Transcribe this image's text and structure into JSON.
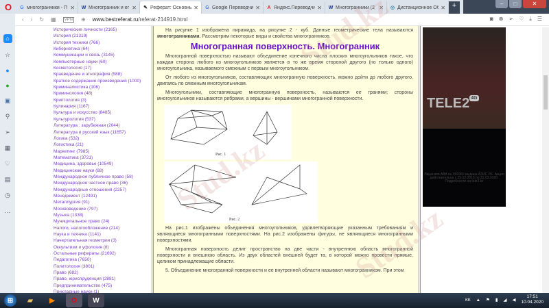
{
  "browser": {
    "tabs": [
      {
        "label": "многогранники - П",
        "favicon": "G",
        "color": "#4285f4"
      },
      {
        "label": "Многогранник и ег",
        "favicon": "W",
        "color": "#1a3a8a"
      },
      {
        "label": "Реферат: Основные",
        "favicon": "✎",
        "color": "#333",
        "active": true
      },
      {
        "label": "Google Переводчи",
        "favicon": "G",
        "color": "#4a7fe0"
      },
      {
        "label": "Яндекс.Переводчи",
        "favicon": "A",
        "color": "#e02020"
      },
      {
        "label": "Многогранники (2",
        "favicon": "W",
        "color": "#1a3a8a"
      },
      {
        "label": "Дистанционное Об",
        "favicon": "◎",
        "color": "#38a"
      }
    ],
    "url_domain": "www.bestreferat.ru",
    "url_path": "/referat-214919.html",
    "vpn": "VPN",
    "new_tab": "+"
  },
  "categories": [
    "Исторические личности (2165)",
    "История (21319)",
    "История техники (766)",
    "Кибернетика (64)",
    "Коммуникации и связь (3145)",
    "Компьютерные науки (60)",
    "Косметология (17)",
    "Краеведение и этнография (588)",
    "Краткое содержание произведений (1000)",
    "Криминалистика (106)",
    "Криминология (48)",
    "Криптология (3)",
    "Кулинария (1167)",
    "Культура и искусство (8485)",
    "Культурология (537)",
    "Литература : зарубежная (2044)",
    "Литература и русский язык (11657)",
    "Логика (532)",
    "Логистика (21)",
    "Маркетинг (7985)",
    "Математика (3721)",
    "Медицина, здоровье (10549)",
    "Медицинские науки (88)",
    "Международное публичное право (58)",
    "Международное частное право (36)",
    "Международные отношения (2257)",
    "Менеджмент (12491)",
    "Металлургия (91)",
    "Москвоведение (797)",
    "Музыка (1338)",
    "Муниципальное право (24)",
    "Налоги, налогообложение (214)",
    "Наука и техника (1141)",
    "Начертательная геометрия (3)",
    "Оккультизм и уфология (8)",
    "Остальные рефераты (21692)",
    "Педагогика (7650)",
    "Политология (3801)",
    "Право (682)",
    "Право, юриспруденция (2881)",
    "Предпринимательство (475)",
    "Прикладные науки (1)"
  ],
  "article": {
    "intro": "На рисунке 1 изображена пирамида, на рисунке 2 - куб. Данные геометрические тела называются",
    "intro_bold": "многогранниками.",
    "intro_rest": " Рассмотрим некоторые виды и свойства многогранников.",
    "heading": "Многогранная поверхность. Многогранник",
    "p1": "Многогранной поверхностью называют объединение конечного числа плоских многоугольников такое, что каждая сторона любого из многоугольников является в то же время стороной другого (но только одного) многоугольника, называемого смежным с первым многоугольником.",
    "p2": "От любого из многоугольников, составляющих многогранную поверхность, можно дойти до любого другого, двигаясь по смежным многоугольникам.",
    "p3": "Многоугольники, составляющие многогранную поверхность, называются ее гранями; стороны многоугольников называются ребрами, а вершины - вершинами многогранной поверхности.",
    "fig1_caption": "Рис. 1",
    "fig2_caption": "Рис. 2",
    "p4": "На рис.1 изображены объединения многоугольников, удовлетворяющие указанным требованиям и являющиеся многогранными поверхностями. На рис.2 изображены фигуры, не являющиеся многогранными поверхностями.",
    "p5": "Многогранная поверхность делит пространство на две части - внутреннюю область многогранной поверхности и внешнюю область. Из двух областей внешней будет та, в которой можно провести прямые, целиком принадлежащие области.",
    "p6": "5. Объединение многогранной поверхности и ее внутренней области называют многогранником. При этом"
  },
  "ad": {
    "brand": "TELE2",
    "badge": "4G",
    "license": "Лицензия АВА № 000960 выдана АЗИС РК. Акция действительна с 25.12.2019 по 31.03.2020. Подробности на tele2.kz"
  },
  "watermark": "Stud.kz",
  "taskbar": {
    "lang": "КК",
    "time": "17:51",
    "date": "10.04.2020"
  }
}
